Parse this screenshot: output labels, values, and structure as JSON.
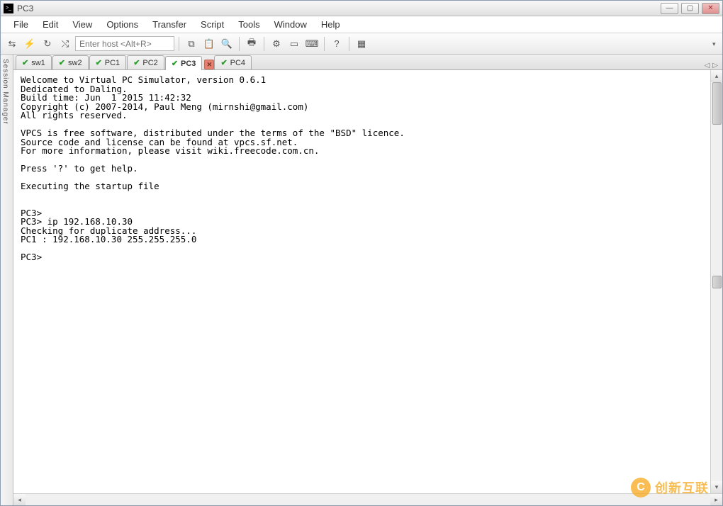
{
  "title": "PC3",
  "menu": [
    "File",
    "Edit",
    "View",
    "Options",
    "Transfer",
    "Script",
    "Tools",
    "Window",
    "Help"
  ],
  "toolbar": {
    "host_placeholder": "Enter host <Alt+R>"
  },
  "sidebar_label": "Session Manager",
  "tabs": [
    {
      "label": "sw1",
      "active": false
    },
    {
      "label": "sw2",
      "active": false
    },
    {
      "label": "PC1",
      "active": false
    },
    {
      "label": "PC2",
      "active": false
    },
    {
      "label": "PC3",
      "active": true,
      "closable": true
    },
    {
      "label": "PC4",
      "active": false
    }
  ],
  "terminal": "Welcome to Virtual PC Simulator, version 0.6.1\nDedicated to Daling.\nBuild time: Jun  1 2015 11:42:32\nCopyright (c) 2007-2014, Paul Meng (mirnshi@gmail.com)\nAll rights reserved.\n\nVPCS is free software, distributed under the terms of the \"BSD\" licence.\nSource code and license can be found at vpcs.sf.net.\nFor more information, please visit wiki.freecode.com.cn.\n\nPress '?' to get help.\n\nExecuting the startup file\n\n\nPC3>\nPC3> ip 192.168.10.30\nChecking for duplicate address...\nPC1 : 192.168.10.30 255.255.255.0\n\nPC3>",
  "watermark": "创新互联"
}
